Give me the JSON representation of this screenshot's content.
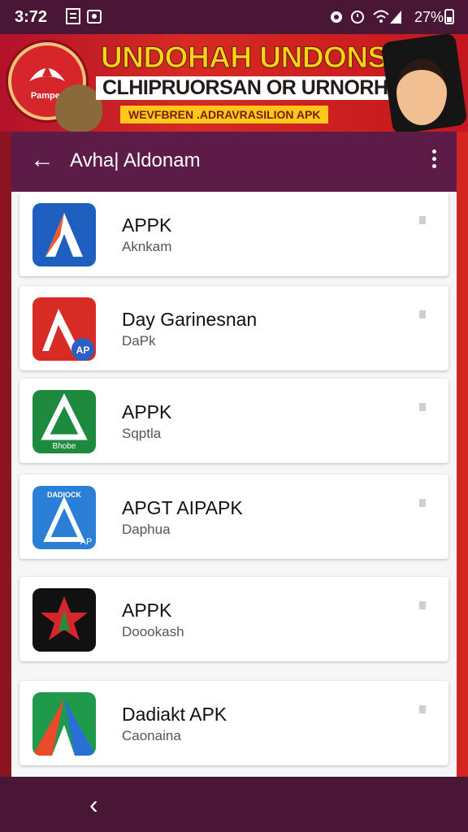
{
  "status_bar": {
    "time": "3:72",
    "battery": "27%"
  },
  "banner": {
    "badge_text": "Pamper",
    "headline": "UNDOHAH UNDONSIAN",
    "subline": "CLHIPRUORSAN OR URNORHOBIA",
    "tagline": "WEVFBREN .ADRAVRASILION APK"
  },
  "app_bar": {
    "title": "Avha| Aldonam"
  },
  "apps": [
    {
      "name": "APPK",
      "subtitle": "Aknkam"
    },
    {
      "name": "Day Garinesnan",
      "subtitle": "DaPk"
    },
    {
      "name": "APPK",
      "subtitle": "Sqptla"
    },
    {
      "name": "APGT AIPAPK",
      "subtitle": "Daphua"
    },
    {
      "name": "APPK",
      "subtitle": "Doookash"
    },
    {
      "name": "Dadiakt APK",
      "subtitle": "Caonaina"
    }
  ],
  "icon_labels": {
    "app2": "AP",
    "app3": "Bhobe",
    "app4_top": "DADIOCK",
    "app4_corner": "AP"
  },
  "colors": {
    "status_bar": "#4a1636",
    "app_bar": "#5d1b48",
    "banner_red": "#c8161e",
    "headline_yellow": "#ffd21a"
  }
}
